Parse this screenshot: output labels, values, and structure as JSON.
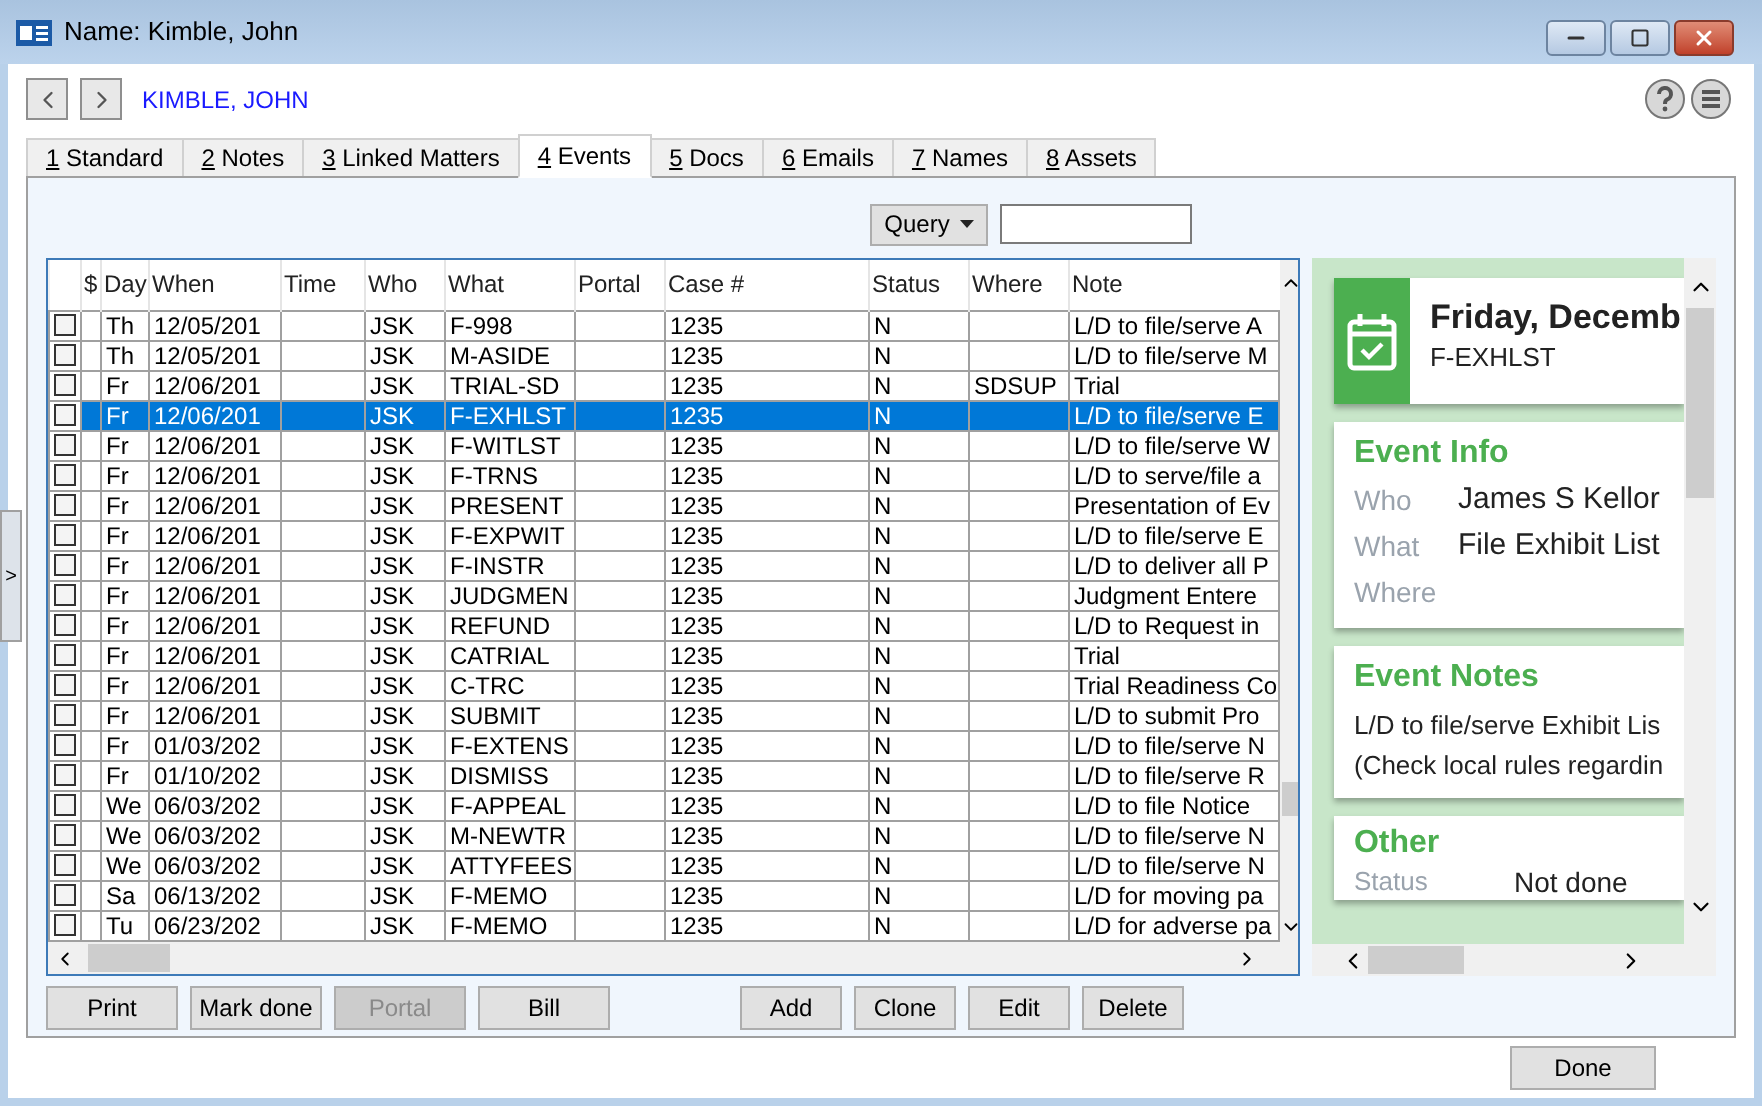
{
  "window": {
    "title": "Name: Kimble, John"
  },
  "record_name": "KIMBLE, JOHN",
  "tabs": [
    {
      "key": "1",
      "label": "Standard",
      "selected": false
    },
    {
      "key": "2",
      "label": "Notes",
      "selected": false
    },
    {
      "key": "3",
      "label": "Linked Matters",
      "selected": false
    },
    {
      "key": "4",
      "label": "Events",
      "selected": true
    },
    {
      "key": "5",
      "label": "Docs",
      "selected": false
    },
    {
      "key": "6",
      "label": "Emails",
      "selected": false
    },
    {
      "key": "7",
      "label": "Names",
      "selected": false
    },
    {
      "key": "8",
      "label": "Assets",
      "selected": false
    }
  ],
  "query": {
    "label": "Query"
  },
  "expander": ">",
  "table": {
    "columns": [
      "$",
      "Day",
      "When",
      "Time",
      "Who",
      "What",
      "Portal",
      "Case #",
      "Status",
      "Where",
      "Note"
    ],
    "rows": [
      {
        "checked": false,
        "selected": false,
        "cells": [
          "",
          "Th",
          "12/05/201",
          "",
          "JSK",
          "F-998",
          "",
          "1235",
          "N",
          "",
          "L/D to file/serve A"
        ]
      },
      {
        "checked": false,
        "selected": false,
        "cells": [
          "",
          "Th",
          "12/05/201",
          "",
          "JSK",
          "M-ASIDE",
          "",
          "1235",
          "N",
          "",
          "L/D to file/serve M"
        ]
      },
      {
        "checked": false,
        "selected": false,
        "cells": [
          "",
          "Fr",
          "12/06/201",
          "",
          "JSK",
          "TRIAL-SD",
          "",
          "1235",
          "N",
          "SDSUP",
          "Trial"
        ]
      },
      {
        "checked": false,
        "selected": true,
        "cells": [
          "",
          "Fr",
          "12/06/201",
          "",
          "JSK",
          "F-EXHLST",
          "",
          "1235",
          "N",
          "",
          "L/D to file/serve E"
        ]
      },
      {
        "checked": false,
        "selected": false,
        "cells": [
          "",
          "Fr",
          "12/06/201",
          "",
          "JSK",
          "F-WITLST",
          "",
          "1235",
          "N",
          "",
          "L/D to file/serve W"
        ]
      },
      {
        "checked": false,
        "selected": false,
        "cells": [
          "",
          "Fr",
          "12/06/201",
          "",
          "JSK",
          "F-TRNS",
          "",
          "1235",
          "N",
          "",
          "L/D to serve/file a"
        ]
      },
      {
        "checked": false,
        "selected": false,
        "cells": [
          "",
          "Fr",
          "12/06/201",
          "",
          "JSK",
          "PRESENT",
          "",
          "1235",
          "N",
          "",
          "Presentation of Ev"
        ]
      },
      {
        "checked": false,
        "selected": false,
        "cells": [
          "",
          "Fr",
          "12/06/201",
          "",
          "JSK",
          "F-EXPWIT",
          "",
          "1235",
          "N",
          "",
          "L/D to file/serve E"
        ]
      },
      {
        "checked": false,
        "selected": false,
        "cells": [
          "",
          "Fr",
          "12/06/201",
          "",
          "JSK",
          "F-INSTR",
          "",
          "1235",
          "N",
          "",
          "L/D to deliver all P"
        ]
      },
      {
        "checked": false,
        "selected": false,
        "cells": [
          "",
          "Fr",
          "12/06/201",
          "",
          "JSK",
          "JUDGMEN",
          "",
          "1235",
          "N",
          "",
          "Judgment Entere"
        ]
      },
      {
        "checked": false,
        "selected": false,
        "cells": [
          "",
          "Fr",
          "12/06/201",
          "",
          "JSK",
          "REFUND",
          "",
          "1235",
          "N",
          "",
          "L/D to Request in"
        ]
      },
      {
        "checked": false,
        "selected": false,
        "cells": [
          "",
          "Fr",
          "12/06/201",
          "",
          "JSK",
          "CATRIAL",
          "",
          "1235",
          "N",
          "",
          "Trial"
        ]
      },
      {
        "checked": false,
        "selected": false,
        "cells": [
          "",
          "Fr",
          "12/06/201",
          "",
          "JSK",
          "C-TRC",
          "",
          "1235",
          "N",
          "",
          "Trial Readiness Co"
        ]
      },
      {
        "checked": false,
        "selected": false,
        "cells": [
          "",
          "Fr",
          "12/06/201",
          "",
          "JSK",
          "SUBMIT",
          "",
          "1235",
          "N",
          "",
          "L/D to submit Pro"
        ]
      },
      {
        "checked": false,
        "selected": false,
        "cells": [
          "",
          "Fr",
          "01/03/202",
          "",
          "JSK",
          "F-EXTENS",
          "",
          "1235",
          "N",
          "",
          "L/D to file/serve N"
        ]
      },
      {
        "checked": false,
        "selected": false,
        "cells": [
          "",
          "Fr",
          "01/10/202",
          "",
          "JSK",
          "DISMISS",
          "",
          "1235",
          "N",
          "",
          "L/D to file/serve R"
        ]
      },
      {
        "checked": false,
        "selected": false,
        "cells": [
          "",
          "We",
          "06/03/202",
          "",
          "JSK",
          "F-APPEAL",
          "",
          "1235",
          "N",
          "",
          "L/D to file Notice"
        ]
      },
      {
        "checked": false,
        "selected": false,
        "cells": [
          "",
          "We",
          "06/03/202",
          "",
          "JSK",
          "M-NEWTR",
          "",
          "1235",
          "N",
          "",
          "L/D to file/serve N"
        ]
      },
      {
        "checked": false,
        "selected": false,
        "cells": [
          "",
          "We",
          "06/03/202",
          "",
          "JSK",
          "ATTYFEES",
          "",
          "1235",
          "N",
          "",
          "L/D to file/serve N"
        ]
      },
      {
        "checked": false,
        "selected": false,
        "cells": [
          "",
          "Sa",
          "06/13/202",
          "",
          "JSK",
          "F-MEMO",
          "",
          "1235",
          "N",
          "",
          "L/D for moving pa"
        ]
      },
      {
        "checked": false,
        "selected": false,
        "cells": [
          "",
          "Tu",
          "06/23/202",
          "",
          "JSK",
          "F-MEMO",
          "",
          "1235",
          "N",
          "",
          "L/D for adverse pa"
        ]
      }
    ]
  },
  "detail": {
    "date": "Friday, Decemb",
    "code": "F-EXHLST",
    "info": {
      "title": "Event Info",
      "fields": [
        {
          "label": "Who",
          "value": "James S Kellor"
        },
        {
          "label": "What",
          "value": "File Exhibit List"
        },
        {
          "label": "Where"
        }
      ]
    },
    "notes": {
      "title": "Event Notes",
      "lines": [
        "L/D to file/serve Exhibit Lis",
        "(Check local rules regardin"
      ]
    },
    "other": {
      "title": "Other",
      "fields": [
        {
          "label": "Status",
          "value": "Not done"
        }
      ]
    }
  },
  "left_buttons": [
    {
      "label": "Print",
      "disabled": false
    },
    {
      "label": "Mark done",
      "disabled": false
    },
    {
      "label": "Portal",
      "disabled": true
    },
    {
      "label": "Bill",
      "disabled": false
    }
  ],
  "right_buttons": [
    {
      "label": "Add",
      "disabled": false
    },
    {
      "label": "Clone",
      "disabled": false
    },
    {
      "label": "Edit",
      "disabled": false
    },
    {
      "label": "Delete",
      "disabled": false
    }
  ],
  "done_button": "Done"
}
